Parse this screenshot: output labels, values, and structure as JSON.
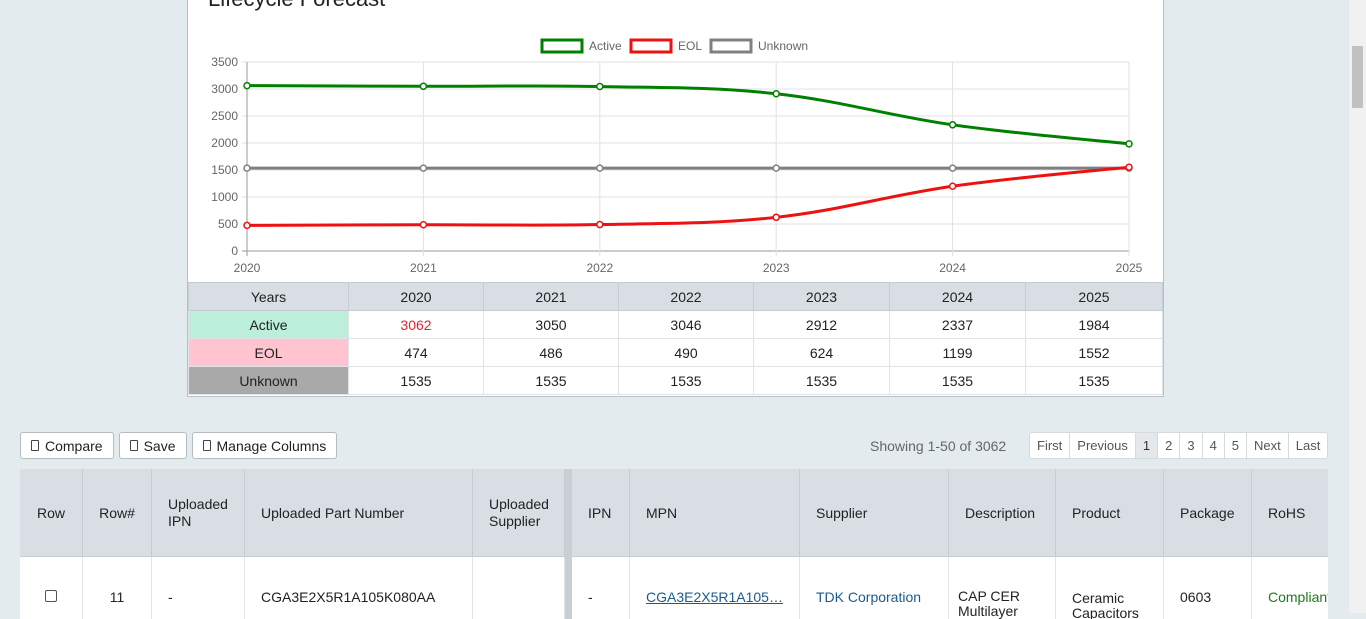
{
  "panel": {
    "title": "Lifecycle Forecast"
  },
  "chart_data": {
    "type": "line",
    "title": "",
    "x": [
      "2020",
      "2021",
      "2022",
      "2023",
      "2024",
      "2025"
    ],
    "ylim": [
      0,
      3500
    ],
    "yticks": [
      0,
      500,
      1000,
      1500,
      2000,
      2500,
      3000,
      3500
    ],
    "grid": true,
    "legend": "top",
    "series": [
      {
        "name": "Active",
        "color": "#008000",
        "values": [
          3062,
          3050,
          3046,
          2912,
          2337,
          1984
        ]
      },
      {
        "name": "EOL",
        "color": "#ee1111",
        "values": [
          474,
          486,
          490,
          624,
          1199,
          1552
        ]
      },
      {
        "name": "Unknown",
        "color": "#808080",
        "values": [
          1535,
          1535,
          1535,
          1535,
          1535,
          1535
        ]
      }
    ]
  },
  "table": {
    "header": [
      "Years",
      "2020",
      "2021",
      "2022",
      "2023",
      "2024",
      "2025"
    ],
    "rows": [
      {
        "label": "Active",
        "values": [
          "3062",
          "3050",
          "3046",
          "2912",
          "2337",
          "1984"
        ]
      },
      {
        "label": "EOL",
        "values": [
          "474",
          "486",
          "490",
          "624",
          "1199",
          "1552"
        ]
      },
      {
        "label": "Unknown",
        "values": [
          "1535",
          "1535",
          "1535",
          "1535",
          "1535",
          "1535"
        ]
      }
    ]
  },
  "toolbar": {
    "compare": "Compare",
    "save": "Save",
    "manage": "Manage Columns"
  },
  "pagination": {
    "showing": "Showing 1-50 of 3062",
    "first": "First",
    "previous": "Previous",
    "pages": [
      "1",
      "2",
      "3",
      "4",
      "5"
    ],
    "next": "Next",
    "last": "Last",
    "current": "1"
  },
  "grid": {
    "columns": {
      "row": "Row",
      "rownum": "Row#",
      "uploaded_ipn": "Uploaded IPN",
      "uploaded_part": "Uploaded Part Number",
      "uploaded_supplier": "Uploaded Supplier",
      "ipn": "IPN",
      "mpn": "MPN",
      "supplier": "Supplier",
      "description": "Description",
      "product": "Product",
      "package": "Package",
      "rohs": "RoHS"
    },
    "row": {
      "rownum": "11",
      "uploaded_ipn": "-",
      "uploaded_part": "CGA3E2X5R1A105K080AA",
      "uploaded_supplier": "",
      "ipn": "-",
      "mpn": "CGA3E2X5R1A105…",
      "supplier": "TDK Corporation",
      "description": "CAP CER Multilayer",
      "product": "Ceramic Capacitors",
      "package": "0603",
      "rohs": "Compliant"
    }
  }
}
